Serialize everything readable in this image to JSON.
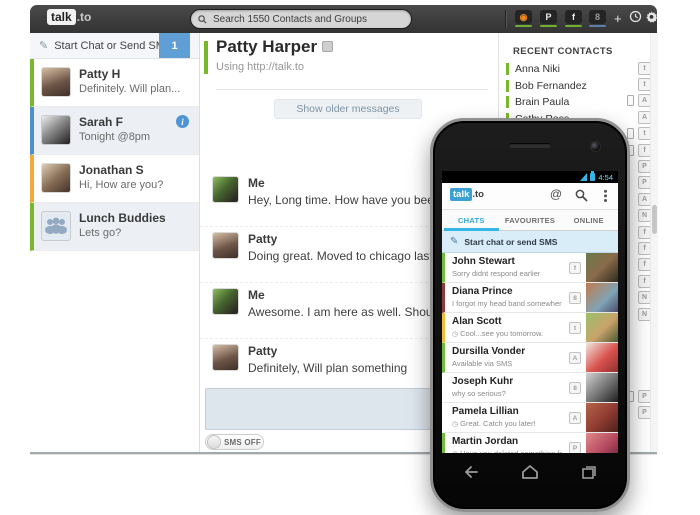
{
  "topbar": {
    "logo_primary": "talk",
    "logo_suffix": ".to",
    "search_placeholder": "Search 1550 Contacts and Groups",
    "accounts": [
      {
        "name": "talkto-account",
        "glyph": "◉",
        "status_color": "#6fae2e"
      },
      {
        "name": "phono-account",
        "glyph": "P",
        "status_color": "#6fae2e"
      },
      {
        "name": "facebook-account",
        "glyph": "f",
        "status_color": "#6fae2e"
      },
      {
        "name": "gtalk-account",
        "glyph": "8",
        "status_color": "#5b7fa6"
      }
    ]
  },
  "sidebar": {
    "compose_label": "Start Chat or Send SMS",
    "compose_badge": "1",
    "contacts": [
      {
        "name": "Patty H",
        "preview": "Definitely. Will plan...",
        "accent": "#79b82d",
        "selected": false
      },
      {
        "name": "Sarah F",
        "preview": "Tonight @8pm",
        "accent": "#4d90cb",
        "selected": true,
        "has_info_icon": true
      },
      {
        "name": "Jonathan S",
        "preview": "Hi, How are you?",
        "accent": "#f2a93c",
        "selected": false
      },
      {
        "name": "Lunch Buddies",
        "preview": "Lets go?",
        "accent": "#79b82d",
        "selected": true,
        "is_group": true
      }
    ]
  },
  "chat": {
    "title": "Patty Harper",
    "subtitle": "Using http://talk.to",
    "older_button_label": "Show older messages",
    "messages": [
      {
        "sender": "Me",
        "text": "Hey, Long time. How have you been?"
      },
      {
        "sender": "Patty",
        "text": "Doing great. Moved to chicago last month"
      },
      {
        "sender": "Me",
        "text": "Awesome. I am here as well. Should meet"
      },
      {
        "sender": "Patty",
        "text": "Definitely, Will plan something"
      }
    ],
    "sms_toggle_label": "SMS OFF"
  },
  "recent": {
    "header": "RECENT CONTACTS",
    "contacts": [
      {
        "name": "Anna Niki"
      },
      {
        "name": "Bob Fernandez"
      },
      {
        "name": "Brain Paula"
      },
      {
        "name": "Cathy Ross"
      }
    ],
    "presence_rows": [
      {
        "phone": false,
        "glyph": "t"
      },
      {
        "phone": false,
        "glyph": "t"
      },
      {
        "phone": true,
        "glyph": "A"
      },
      {
        "phone": false,
        "glyph": "A"
      },
      {
        "phone": true,
        "glyph": "t"
      },
      {
        "phone": true,
        "glyph": "f"
      },
      {
        "phone": false,
        "glyph": "P"
      },
      {
        "phone": false,
        "glyph": "P"
      },
      {
        "phone": false,
        "glyph": "A"
      },
      {
        "phone": false,
        "glyph": "N"
      },
      {
        "phone": false,
        "glyph": "f"
      },
      {
        "phone": false,
        "glyph": "f"
      },
      {
        "phone": false,
        "glyph": "f"
      },
      {
        "phone": false,
        "glyph": "f"
      },
      {
        "phone": false,
        "glyph": "N"
      },
      {
        "phone": false,
        "glyph": "N"
      },
      {
        "phone": false,
        "glyph": ""
      },
      {
        "phone": false,
        "glyph": ""
      },
      {
        "phone": false,
        "glyph": ""
      },
      {
        "phone": false,
        "glyph": ""
      },
      {
        "phone": true,
        "glyph": "P"
      },
      {
        "phone": false,
        "glyph": "P"
      }
    ]
  },
  "phone": {
    "status_time": "4:54",
    "logo_primary": "talk",
    "logo_suffix": ".to",
    "at_icon": "@",
    "tabs": [
      {
        "label": "CHATS",
        "active": true
      },
      {
        "label": "FAVOURITES",
        "active": false
      },
      {
        "label": "ONLINE",
        "active": false
      }
    ],
    "compose_label": "Start chat or send SMS",
    "chats": [
      {
        "name": "John Stewart",
        "preview": "Sorry didnt respond earlier",
        "accent": "#6ebe3b",
        "network": "f",
        "clock": false
      },
      {
        "name": "Diana Prince",
        "preview": "I forgot my head band somewhere!",
        "accent": "#8e3b3b",
        "network": "8",
        "clock": false
      },
      {
        "name": "Alan Scott",
        "preview": "Cool...see you tomorrow.",
        "accent": "#eebd3c",
        "network": "t",
        "clock": true
      },
      {
        "name": "Dursilla Vonder",
        "preview": "Available via SMS",
        "accent": "#6ebe3b",
        "network": "A",
        "clock": false
      },
      {
        "name": "Joseph Kuhr",
        "preview": "why so serious?",
        "accent": "",
        "network": "8",
        "clock": false
      },
      {
        "name": "Pamela Lillian",
        "preview": "Great. Catch you later!",
        "accent": "",
        "network": "A",
        "clock": true
      },
      {
        "name": "Martin Jordan",
        "preview": "Have you deleted something fr..",
        "accent": "#6ebe3b",
        "network": "P",
        "clock": true
      }
    ]
  }
}
